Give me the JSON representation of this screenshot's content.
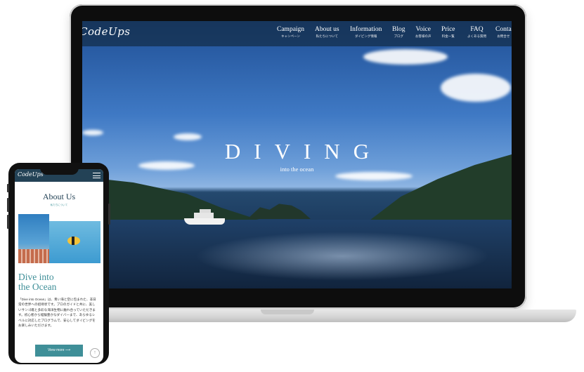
{
  "laptop": {
    "site": {
      "logo": "CodeUps",
      "nav": [
        {
          "en": "Campaign",
          "jp": "キャンペーン"
        },
        {
          "en": "About us",
          "jp": "私たちについて"
        },
        {
          "en": "Information",
          "jp": "ダイビング情報"
        },
        {
          "en": "Blog",
          "jp": "ブログ"
        },
        {
          "en": "Voice",
          "jp": "お客様の声"
        },
        {
          "en": "Price",
          "jp": "料金一覧"
        },
        {
          "en": "FAQ",
          "jp": "よくある質問"
        },
        {
          "en": "Conta",
          "jp": "お問合せ"
        }
      ],
      "hero": {
        "title": "DIVING",
        "subtitle": "into the ocean"
      }
    }
  },
  "phone": {
    "site": {
      "logo": "CodeUps",
      "about_title": "About Us",
      "about_sub": "私たちについて",
      "dive_title": "Dive into\nthe Ocean",
      "dive_text": "「Dive into Ocean」は、青い海と空に包まれた、非日常の世界への招待状です。プロのガイドと共に、美しいサンゴ礁と多彩な海洋生物に触れ合っていただきます。初心者から経験豊かなダイバーまで、あらゆるレベルに対応したプログラムで、安心してダイビングをお楽しみいただけます。",
      "view_more": "View more  ⟶",
      "scroll_top": "↑"
    }
  }
}
